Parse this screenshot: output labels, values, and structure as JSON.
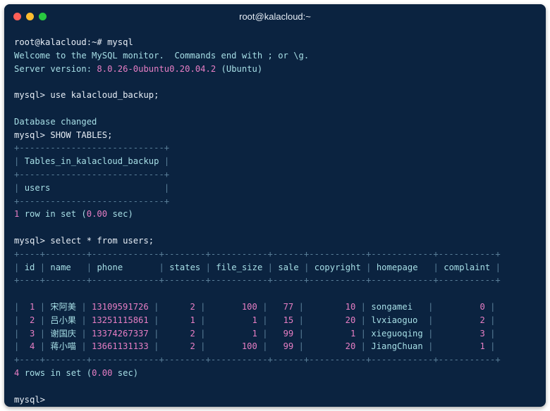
{
  "window": {
    "title": "root@kalacloud:~",
    "traffic_lights": {
      "close": "#fe5f57",
      "minimize": "#febc2e",
      "maximize": "#28c840"
    }
  },
  "colors": {
    "background": "#0b2340",
    "text": "#a7dfe6",
    "number": "#e77ec4",
    "border": "#5a7f99"
  },
  "session": {
    "shell_prompt": "root@kalacloud:~#",
    "shell_command": "mysql",
    "welcome": "Welcome to the MySQL monitor.  Commands end with ; or \\g.",
    "server_version_label": "Server version:",
    "server_version": "8.0.26-0ubuntu0.20.04.2",
    "server_version_suffix": "(Ubuntu)",
    "mysql_prompt": "mysql>",
    "cmd_use": "use kalacloud_backup;",
    "db_changed": "Database changed",
    "cmd_show": "SHOW TABLES;",
    "tables_header": "Tables_in_kalacloud_backup",
    "tables": [
      "users"
    ],
    "tables_count": "1",
    "tables_result_text": "row in set",
    "tables_time": "0.00",
    "cmd_select": "select * from users;",
    "users_columns": [
      "id",
      "name",
      "phone",
      "states",
      "file_size",
      "sale",
      "copyright",
      "homepage",
      "complaint"
    ],
    "users_rows": [
      [
        "1",
        "宋阿美",
        "13109591726",
        "2",
        "100",
        "77",
        "10",
        "songamei",
        "0"
      ],
      [
        "2",
        "吕小果",
        "13251115861",
        "1",
        "1",
        "15",
        "20",
        "lvxiaoguo",
        "2"
      ],
      [
        "3",
        "谢国庆",
        "13374267337",
        "2",
        "1",
        "99",
        "1",
        "xieguoqing",
        "3"
      ],
      [
        "4",
        "蒋小喵",
        "13661131133",
        "2",
        "100",
        "99",
        "20",
        "JiangChuan",
        "1"
      ]
    ],
    "users_count": "4",
    "users_result_text": "rows in set",
    "users_time": "0.00"
  }
}
